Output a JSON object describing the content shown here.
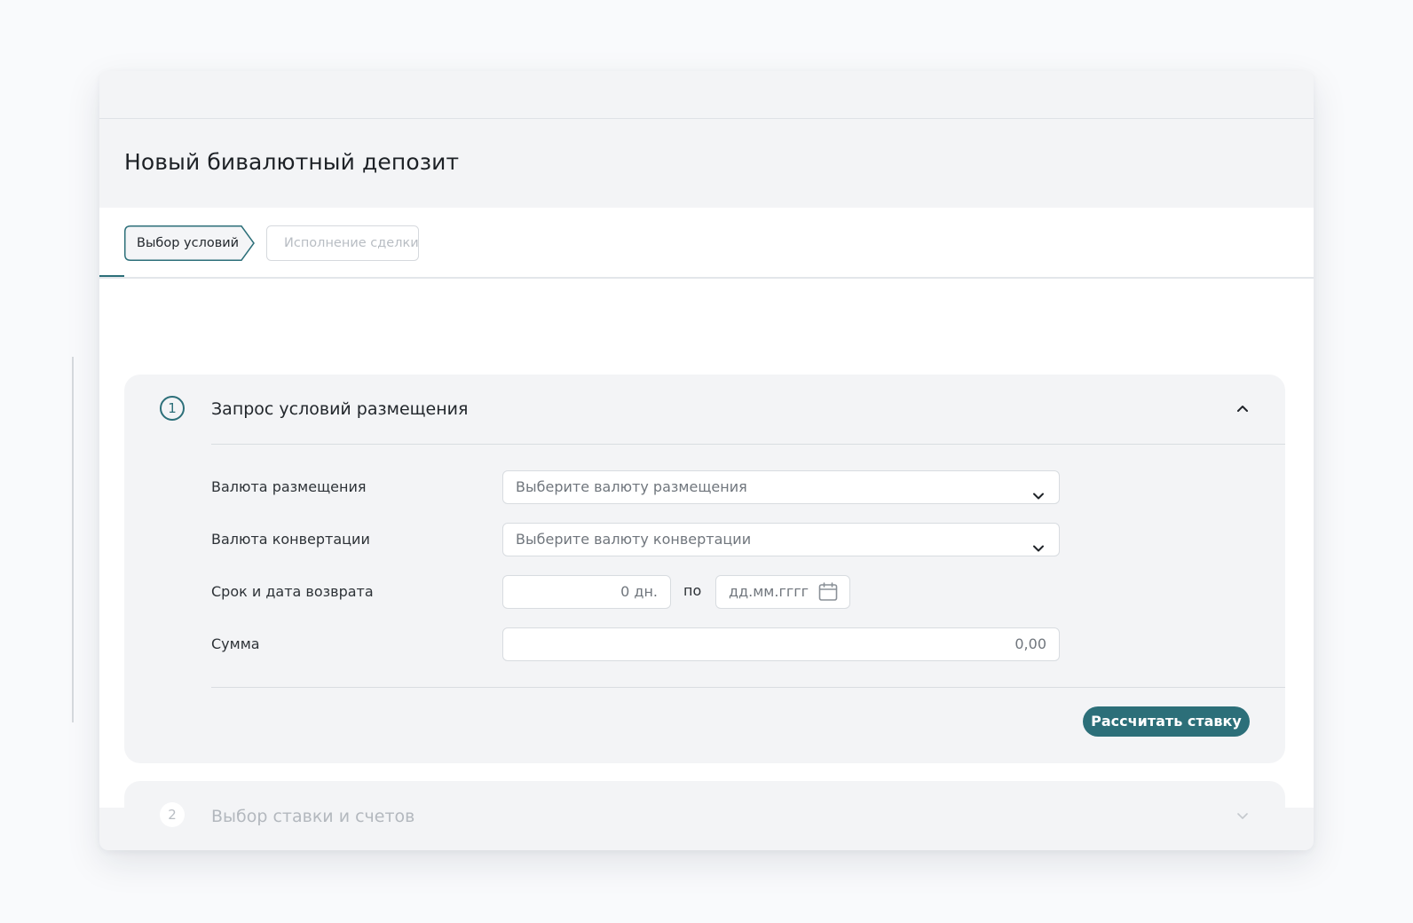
{
  "page": {
    "title": "Новый бивалютный депозит"
  },
  "steps": [
    {
      "label": "Выбор условий",
      "state": "active"
    },
    {
      "label": "Исполнение сделки",
      "state": "disabled"
    }
  ],
  "section1": {
    "number": "1",
    "title": "Запрос условий размещения",
    "fields": {
      "placement_currency": {
        "label": "Валюта размещения",
        "placeholder": "Выберите валюту размещения"
      },
      "conversion_currency": {
        "label": "Валюта конвертации",
        "placeholder": "Выберите валюту конвертации"
      },
      "term": {
        "label": "Срок и дата возврата",
        "days_value": "0 дн.",
        "by_label": "по",
        "date_placeholder": "дд.мм.гггг"
      },
      "amount": {
        "label": "Сумма",
        "value": "0,00"
      }
    },
    "calc_button": "Рассчитать ставку"
  },
  "section2": {
    "number": "2",
    "title": "Выбор ставки и счетов"
  },
  "colors": {
    "accent": "#2c6f79",
    "muted": "#b8bdc3"
  }
}
